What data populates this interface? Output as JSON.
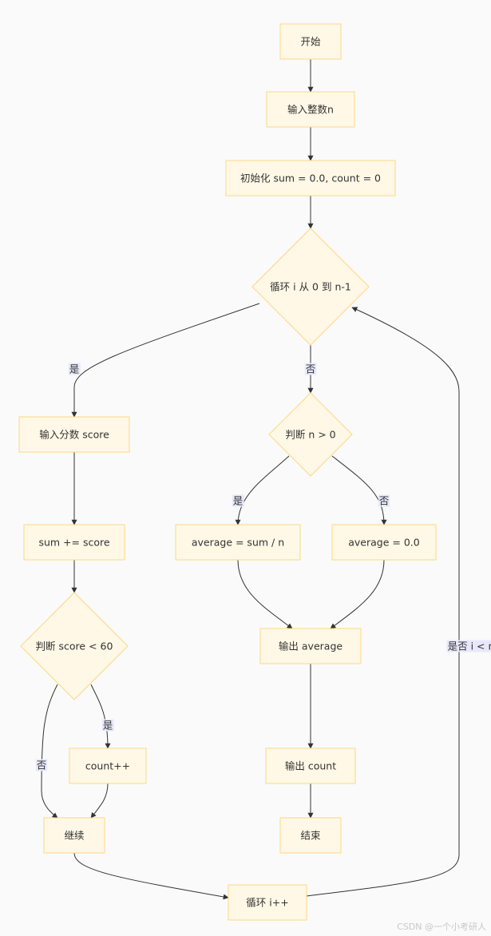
{
  "diagram": {
    "type": "flowchart",
    "colors": {
      "node_fill": "#fff8e6",
      "node_stroke": "#fcd884",
      "edge": "#333333",
      "label_bg": "#e8e8fb",
      "text": "#333333",
      "background": "#fafafa"
    },
    "nodes": [
      {
        "id": "start",
        "shape": "rect",
        "label": "开始"
      },
      {
        "id": "input_n",
        "shape": "rect",
        "label": "输入整数n"
      },
      {
        "id": "init",
        "shape": "rect",
        "label": "初始化 sum = 0.0, count = 0"
      },
      {
        "id": "loop",
        "shape": "diamond",
        "label": "循环 i 从 0 到 n-1"
      },
      {
        "id": "input_score",
        "shape": "rect",
        "label": "输入分数 score"
      },
      {
        "id": "sum_add",
        "shape": "rect",
        "label": "sum += score"
      },
      {
        "id": "check_score",
        "shape": "diamond",
        "label": "判断 score < 60"
      },
      {
        "id": "count_inc",
        "shape": "rect",
        "label": "count++"
      },
      {
        "id": "continue",
        "shape": "rect",
        "label": "继续"
      },
      {
        "id": "loop_inc",
        "shape": "rect",
        "label": "循环 i++"
      },
      {
        "id": "check_n",
        "shape": "diamond",
        "label": "判断 n > 0"
      },
      {
        "id": "avg_calc",
        "shape": "rect",
        "label": "average = sum / n"
      },
      {
        "id": "avg_zero",
        "shape": "rect",
        "label": "average = 0.0"
      },
      {
        "id": "out_avg",
        "shape": "rect",
        "label": "输出 average"
      },
      {
        "id": "out_count",
        "shape": "rect",
        "label": "输出 count"
      },
      {
        "id": "end",
        "shape": "rect",
        "label": "结束"
      }
    ],
    "edges": [
      {
        "from": "start",
        "to": "input_n",
        "label": ""
      },
      {
        "from": "input_n",
        "to": "init",
        "label": ""
      },
      {
        "from": "init",
        "to": "loop",
        "label": ""
      },
      {
        "from": "loop",
        "to": "input_score",
        "label": "是"
      },
      {
        "from": "loop",
        "to": "check_n",
        "label": "否"
      },
      {
        "from": "input_score",
        "to": "sum_add",
        "label": ""
      },
      {
        "from": "sum_add",
        "to": "check_score",
        "label": ""
      },
      {
        "from": "check_score",
        "to": "count_inc",
        "label": "是"
      },
      {
        "from": "check_score",
        "to": "continue",
        "label": "否"
      },
      {
        "from": "count_inc",
        "to": "continue",
        "label": ""
      },
      {
        "from": "continue",
        "to": "loop_inc",
        "label": ""
      },
      {
        "from": "loop_inc",
        "to": "loop",
        "label": "是否 i < n"
      },
      {
        "from": "check_n",
        "to": "avg_calc",
        "label": "是"
      },
      {
        "from": "check_n",
        "to": "avg_zero",
        "label": "否"
      },
      {
        "from": "avg_calc",
        "to": "out_avg",
        "label": ""
      },
      {
        "from": "avg_zero",
        "to": "out_avg",
        "label": ""
      },
      {
        "from": "out_avg",
        "to": "out_count",
        "label": ""
      },
      {
        "from": "out_count",
        "to": "end",
        "label": ""
      }
    ]
  },
  "watermark": "CSDN @一个小考研人"
}
